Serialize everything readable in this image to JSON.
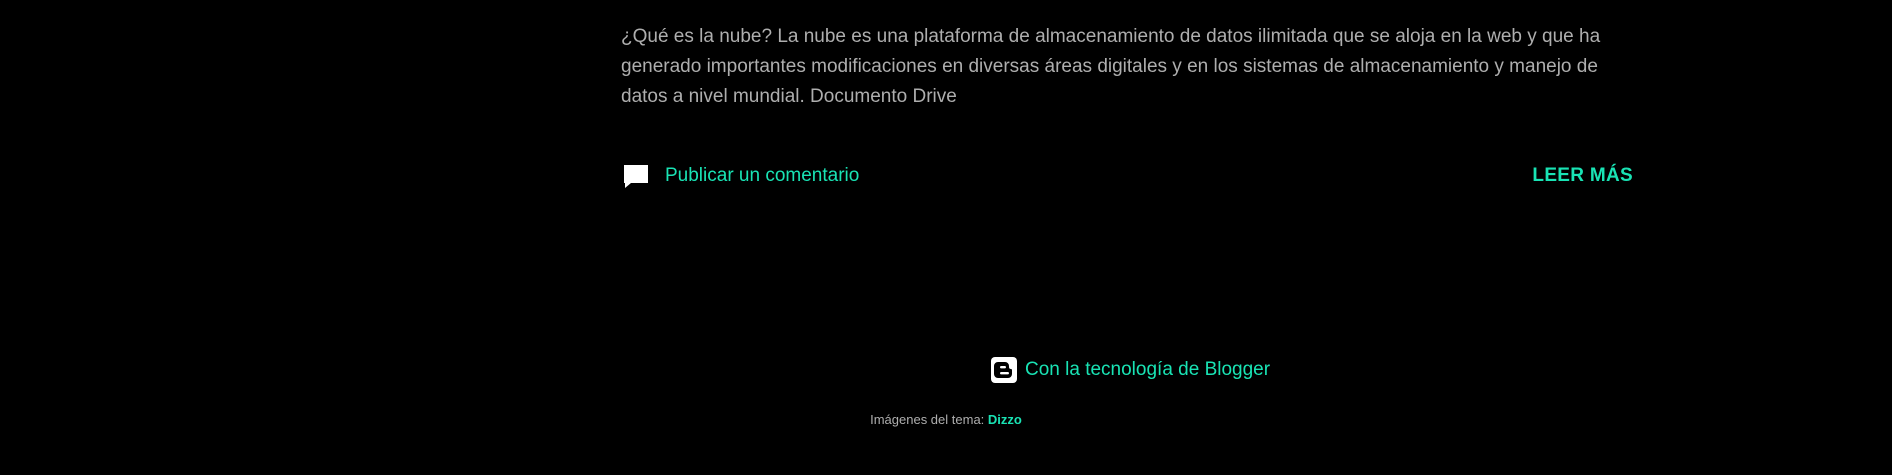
{
  "post": {
    "snippet": " ¿Qué es la nube? La nube es una plataforma de almacenamiento de datos ilimitada que se aloja en la web y que ha generado importantes modificaciones en diversas áreas digitales y en los sistemas de almacenamiento y manejo de datos a nivel mundial. Documento Drive",
    "comment_label": "Publicar un comentario",
    "comment_icon": "comment-icon",
    "read_more_label": "LEER MÁS"
  },
  "footer": {
    "powered_by_label": "Con la tecnología de Blogger",
    "blogger_icon": "blogger-icon",
    "theme_images_label": "Imágenes del tema:",
    "theme_author": "Dizzo"
  },
  "colors": {
    "background": "#000000",
    "accent": "#19e3b4",
    "text": "#aeaeae"
  }
}
